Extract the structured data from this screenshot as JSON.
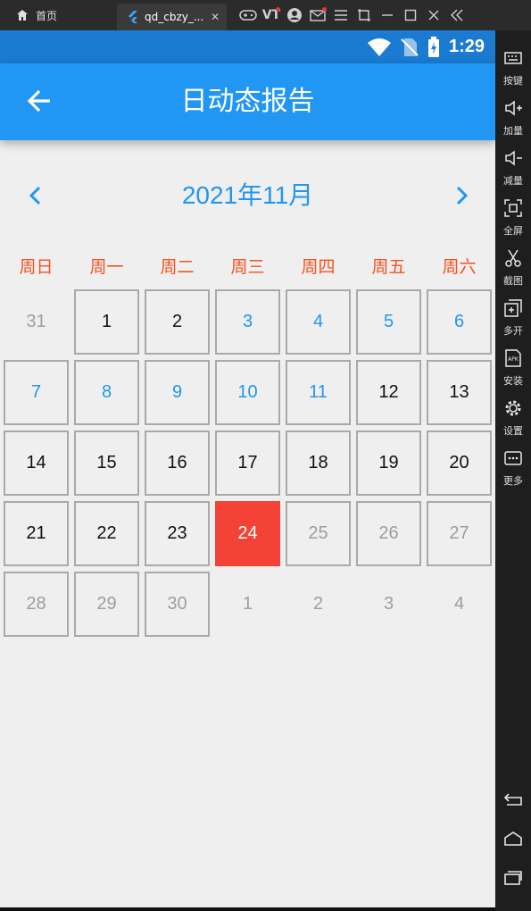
{
  "emulator": {
    "home_tab": "首页",
    "app_tab": "qd_cbzy_...",
    "tab_close": "✕",
    "tools": [
      "gamepad-icon",
      "vt-icon",
      "user-icon",
      "mail-icon",
      "menu-icon",
      "crop-icon",
      "minimize-icon",
      "maximize-icon",
      "close-icon",
      "collapse-icon"
    ],
    "vt_label": "VT",
    "sidebar": [
      {
        "icon": "keyboard-icon",
        "label": "按键"
      },
      {
        "icon": "volume-up-icon",
        "label": "加量"
      },
      {
        "icon": "volume-down-icon",
        "label": "减量"
      },
      {
        "icon": "fullscreen-icon",
        "label": "全屏"
      },
      {
        "icon": "scissors-icon",
        "label": "截图"
      },
      {
        "icon": "multi-open-icon",
        "label": "多开"
      },
      {
        "icon": "apk-icon",
        "label": "安装"
      },
      {
        "icon": "settings-icon",
        "label": "设置"
      },
      {
        "icon": "more-icon",
        "label": "更多"
      }
    ],
    "apk_text": "APK"
  },
  "status_bar": {
    "time": "1:29",
    "color": "#1a7bd0"
  },
  "app_bar": {
    "title": "日动态报告",
    "color": "#2196f3"
  },
  "calendar": {
    "month_label": "2021年11月",
    "weekdays": [
      "周日",
      "周一",
      "周二",
      "周三",
      "周四",
      "周五",
      "周六"
    ],
    "weeks": [
      [
        {
          "label": "31",
          "style": "grey",
          "boxed": false
        },
        {
          "label": "1",
          "style": "black",
          "boxed": true
        },
        {
          "label": "2",
          "style": "black",
          "boxed": true
        },
        {
          "label": "3",
          "style": "blue",
          "boxed": true
        },
        {
          "label": "4",
          "style": "blue",
          "boxed": true
        },
        {
          "label": "5",
          "style": "blue",
          "boxed": true
        },
        {
          "label": "6",
          "style": "blue",
          "boxed": true
        }
      ],
      [
        {
          "label": "7",
          "style": "blue",
          "boxed": true
        },
        {
          "label": "8",
          "style": "blue",
          "boxed": true
        },
        {
          "label": "9",
          "style": "blue",
          "boxed": true
        },
        {
          "label": "10",
          "style": "blue",
          "boxed": true
        },
        {
          "label": "11",
          "style": "blue",
          "boxed": true
        },
        {
          "label": "12",
          "style": "black",
          "boxed": true
        },
        {
          "label": "13",
          "style": "black",
          "boxed": true
        }
      ],
      [
        {
          "label": "14",
          "style": "black",
          "boxed": true
        },
        {
          "label": "15",
          "style": "black",
          "boxed": true
        },
        {
          "label": "16",
          "style": "black",
          "boxed": true
        },
        {
          "label": "17",
          "style": "black",
          "boxed": true
        },
        {
          "label": "18",
          "style": "black",
          "boxed": true
        },
        {
          "label": "19",
          "style": "black",
          "boxed": true
        },
        {
          "label": "20",
          "style": "black",
          "boxed": true
        }
      ],
      [
        {
          "label": "21",
          "style": "black",
          "boxed": true
        },
        {
          "label": "22",
          "style": "black",
          "boxed": true
        },
        {
          "label": "23",
          "style": "black",
          "boxed": true
        },
        {
          "label": "24",
          "style": "today",
          "boxed": false
        },
        {
          "label": "25",
          "style": "grey",
          "boxed": true
        },
        {
          "label": "26",
          "style": "grey",
          "boxed": true
        },
        {
          "label": "27",
          "style": "grey",
          "boxed": true
        }
      ],
      [
        {
          "label": "28",
          "style": "grey",
          "boxed": true
        },
        {
          "label": "29",
          "style": "grey",
          "boxed": true
        },
        {
          "label": "30",
          "style": "grey",
          "boxed": true
        },
        {
          "label": "1",
          "style": "grey",
          "boxed": false
        },
        {
          "label": "2",
          "style": "grey",
          "boxed": false
        },
        {
          "label": "3",
          "style": "grey",
          "boxed": false
        },
        {
          "label": "4",
          "style": "grey",
          "boxed": false
        }
      ]
    ],
    "colors": {
      "accent": "#2196f3",
      "weekday": "#f4511e",
      "today": "#f44336",
      "muted": "#9e9e9e"
    }
  }
}
